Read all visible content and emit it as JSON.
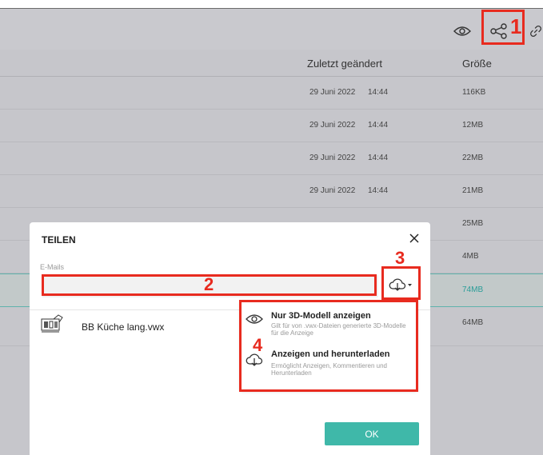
{
  "toolbar": {
    "icons": [
      "eye-icon",
      "share-icon",
      "link-icon"
    ]
  },
  "table": {
    "columns": [
      "Zuletzt geändert",
      "Größe"
    ],
    "rows": [
      {
        "date": "29 Juni 2022",
        "time": "14:44",
        "size": "116KB"
      },
      {
        "date": "29 Juni 2022",
        "time": "14:44",
        "size": "12MB"
      },
      {
        "date": "29 Juni 2022",
        "time": "14:44",
        "size": "22MB"
      },
      {
        "date": "29 Juni 2022",
        "time": "14:44",
        "size": "21MB"
      },
      {
        "date": "",
        "time": "",
        "size": "25MB"
      },
      {
        "date": "",
        "time": "",
        "size": "4MB"
      },
      {
        "date": "",
        "time": "",
        "size": "74MB",
        "selected": true
      },
      {
        "date": "",
        "time": "",
        "size": "64MB"
      }
    ]
  },
  "annotations": [
    "1",
    "2",
    "3",
    "4"
  ],
  "annotation_color": "#e82b1f",
  "accent_color": "#3fb8a9",
  "modal": {
    "title": "TEILEN",
    "email_label": "E-Mails",
    "email_value": "",
    "file_name": "BB Küche lang.vwx",
    "ok_label": "OK"
  },
  "dropdown": {
    "items": [
      {
        "icon": "eye-icon",
        "title": "Nur 3D-Modell anzeigen",
        "description": "Gilt für von .vwx-Dateien generierte 3D-Modelle für die Anzeige"
      },
      {
        "icon": "cloud-download-icon",
        "title": "Anzeigen und herunterladen",
        "description": "Ermöglicht Anzeigen, Kommentieren und Herunterladen"
      }
    ]
  }
}
